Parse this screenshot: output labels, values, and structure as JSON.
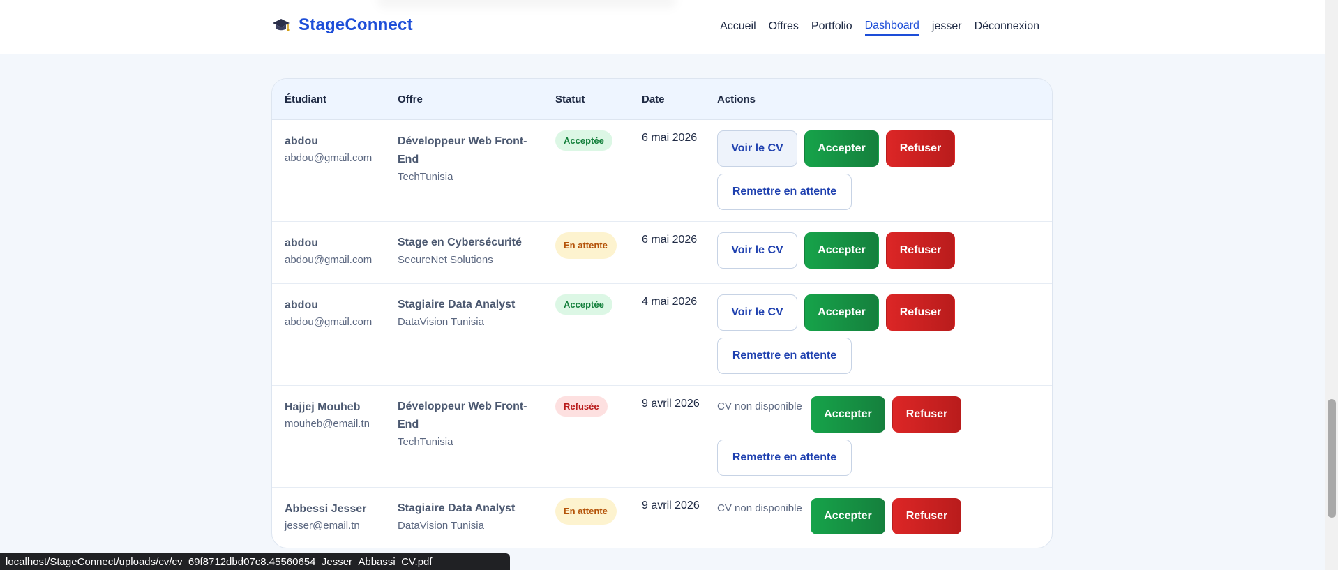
{
  "header": {
    "brand_name": "StageConnect",
    "brand_icon": "graduation-cap-icon",
    "nav": [
      {
        "label": "Accueil",
        "active": false
      },
      {
        "label": "Offres",
        "active": false
      },
      {
        "label": "Portfolio",
        "active": false
      },
      {
        "label": "Dashboard",
        "active": true
      },
      {
        "label": "jesser",
        "active": false
      },
      {
        "label": "Déconnexion",
        "active": false
      }
    ]
  },
  "table": {
    "columns": {
      "student": "Étudiant",
      "offer": "Offre",
      "status": "Statut",
      "date": "Date",
      "actions": "Actions"
    },
    "labels": {
      "view_cv": "Voir le CV",
      "accept": "Accepter",
      "refuse": "Refuser",
      "reset": "Remettre en attente",
      "cv_unavailable": "CV non disponible"
    },
    "rows": [
      {
        "student_name": "abdou",
        "student_email": "abdou@gmail.com",
        "offer_title": "Développeur Web Front-End",
        "company": "TechTunisia",
        "status": "Acceptée",
        "status_kind": "accepted",
        "date": "6 mai 2026",
        "has_cv": true,
        "show_reset": true
      },
      {
        "student_name": "abdou",
        "student_email": "abdou@gmail.com",
        "offer_title": "Stage en Cybersécurité",
        "company": "SecureNet Solutions",
        "status": "En attente",
        "status_kind": "pending",
        "date": "6 mai 2026",
        "has_cv": true,
        "show_reset": false
      },
      {
        "student_name": "abdou",
        "student_email": "abdou@gmail.com",
        "offer_title": "Stagiaire Data Analyst",
        "company": "DataVision Tunisia",
        "status": "Acceptée",
        "status_kind": "accepted",
        "date": "4 mai 2026",
        "has_cv": true,
        "show_reset": true
      },
      {
        "student_name": "Hajjej Mouheb",
        "student_email": "mouheb@email.tn",
        "offer_title": "Développeur Web Front-End",
        "company": "TechTunisia",
        "status": "Refusée",
        "status_kind": "refused",
        "date": "9 avril 2026",
        "has_cv": false,
        "show_reset": true
      },
      {
        "student_name": "Abbessi Jesser",
        "student_email": "jesser@email.tn",
        "offer_title": "Stagiaire Data Analyst",
        "company": "DataVision Tunisia",
        "status": "En attente",
        "status_kind": "pending",
        "date": "9 avril 2026",
        "has_cv": false,
        "show_reset": false
      }
    ]
  },
  "status_bar": {
    "url": "localhost/StageConnect/uploads/cv/cv_69f8712dbd07c8.45560654_Jesser_Abbassi_CV.pdf"
  },
  "colors": {
    "brand": "#1d4ed8",
    "accept": "#16a34a",
    "refuse": "#dc2626"
  }
}
